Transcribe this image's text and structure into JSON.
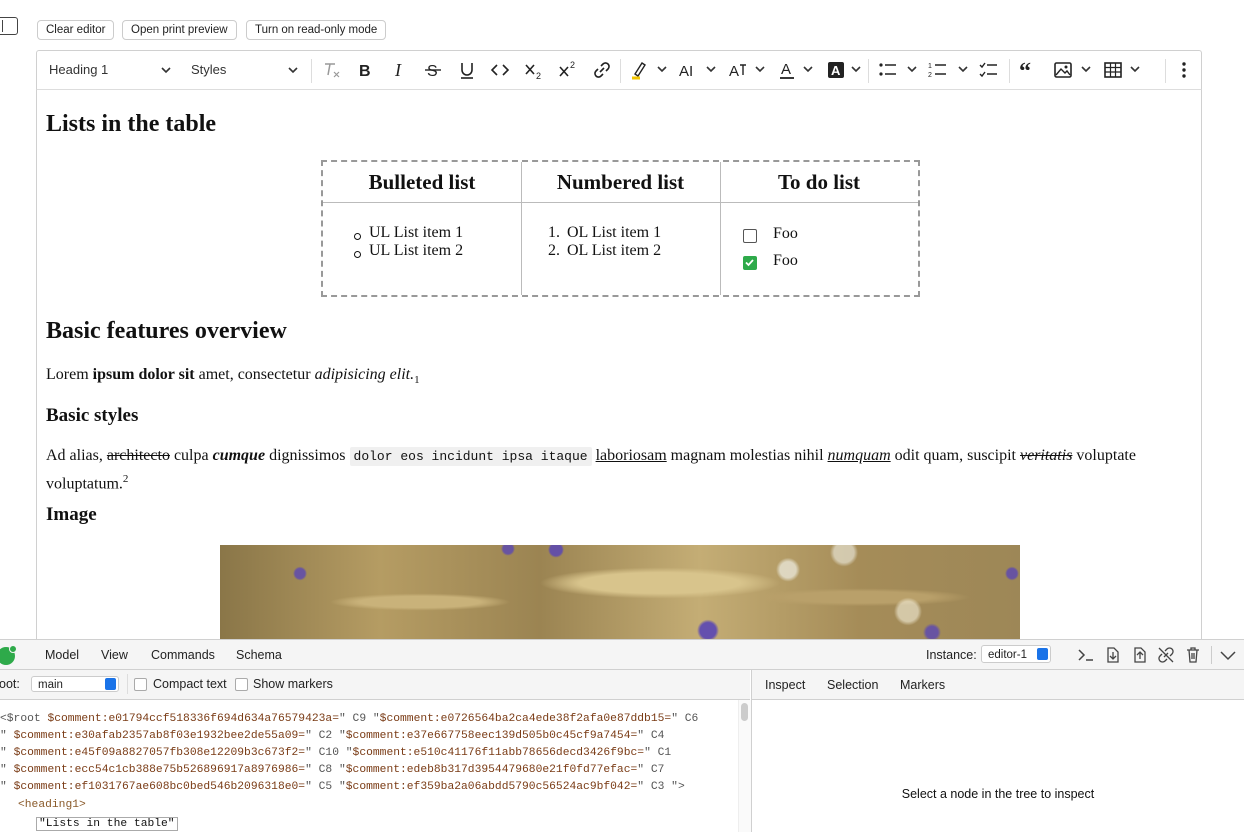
{
  "top": {
    "clear_editor": "Clear editor",
    "print_preview": "Open print preview",
    "read_only": "Turn on read-only mode"
  },
  "toolbar": {
    "heading": "Heading 1",
    "styles": "Styles"
  },
  "content": {
    "h1": "Lists in the table",
    "table": {
      "headers": [
        "Bulleted list",
        "Numbered list",
        "To do list"
      ],
      "bulleted": [
        "UL List item 1",
        "UL List item 2"
      ],
      "numbered": [
        "OL List item 1",
        "OL List item 2"
      ],
      "numbered_markers": [
        "1.",
        "2."
      ],
      "todo": [
        {
          "label": "Foo",
          "checked": false
        },
        {
          "label": "Foo",
          "checked": true
        }
      ]
    },
    "h2": "Basic features overview",
    "p1": {
      "a": "Lorem ",
      "b": "ipsum dolor sit",
      "c": " amet, consectetur ",
      "d": "adipisicing elit.",
      "sub": "1"
    },
    "h3a": "Basic styles",
    "p2": {
      "a": "Ad alias, ",
      "strike1": "architecto",
      "b": " culpa ",
      "bi": "cumque",
      "c": " dignissimos ",
      "code": "dolor eos incidunt ipsa itaque",
      "d": " ",
      "u": "laboriosam",
      "e": " magnam molestias nihil ",
      "ui": "numquam",
      "f": " odit quam, suscipit ",
      "strike2": "veritatis",
      "g": " voluptate",
      "line2": "voluptatum.",
      "sup": "2"
    },
    "h3b": "Image"
  },
  "inspector": {
    "tabs": [
      "Model",
      "View",
      "Commands",
      "Schema"
    ],
    "active_tab": "Model",
    "instance_label": "Instance:",
    "instance_value": "editor-1",
    "root_label": "Root:",
    "root_value": "main",
    "compact_text": "Compact text",
    "show_markers": "Show markers",
    "right_tabs": [
      "Inspect",
      "Selection",
      "Markers"
    ],
    "hint": "Select a node in the tree to inspect",
    "tree_lines": [
      {
        "pre": "<$root ",
        "pairs": [
          [
            "$comment:e01794ccf518336f694d634a76579423a=",
            "\" C9 \""
          ],
          [
            "$comment:e0726564ba2ca4ede38f2afa0e87ddb15=",
            "\" C6"
          ]
        ]
      },
      {
        "pre": "\" ",
        "pairs": [
          [
            "$comment:e30afab2357ab8f03e1932bee2de55a09=",
            "\" C2 \""
          ],
          [
            "$comment:e37e667758eec139d505b0c45cf9a7454=",
            "\" C4"
          ]
        ]
      },
      {
        "pre": "\" ",
        "pairs": [
          [
            "$comment:e45f09a8827057fb308e12209b3c673f2=",
            "\" C10 \""
          ],
          [
            "$comment:e510c41176f11abb78656decd3426f9bc=",
            "\" C1"
          ]
        ]
      },
      {
        "pre": "\" ",
        "pairs": [
          [
            "$comment:ecc54c1cb388e75b526896917a8976986=",
            "\" C8 \""
          ],
          [
            "$comment:edeb8b317d3954479680e21f0fd77efac=",
            "\" C7"
          ]
        ]
      },
      {
        "pre": "\" ",
        "pairs": [
          [
            "$comment:ef1031767ae608bc0bed546b2096318e0=",
            "\" C5 \""
          ],
          [
            "$comment:ef359ba2a06abdd5790c56524ac9bf042=",
            "\" C3 \">"
          ]
        ]
      }
    ],
    "heading_tag": "<heading1>",
    "text_node": "\"Lists in the table\""
  }
}
